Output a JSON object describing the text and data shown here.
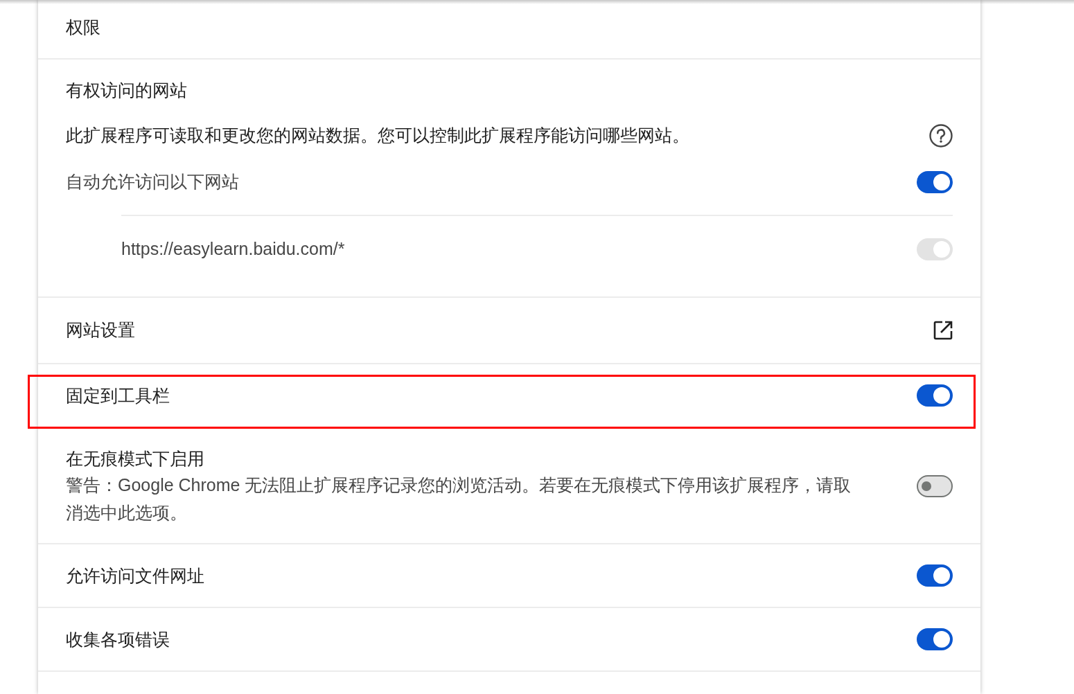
{
  "section_title": "权限",
  "site_access": {
    "title": "有权访问的网站",
    "description": "此扩展程序可读取和更改您的网站数据。您可以控制此扩展程序能访问哪些网站。",
    "auto_allow": {
      "label": "自动允许访问以下网站",
      "on": true
    },
    "sites": [
      {
        "url": "https://easylearn.baidu.com/*",
        "on": true,
        "disabled": true
      }
    ]
  },
  "groups": [
    {
      "rows": [
        {
          "kind": "link",
          "label": "网站设置",
          "highlighted": false
        }
      ]
    },
    {
      "rows": [
        {
          "kind": "toggle",
          "label": "固定到工具栏",
          "on": true,
          "highlighted": true
        },
        {
          "kind": "toggle",
          "label": "在无痕模式下启用",
          "description": "警告：Google Chrome 无法阻止扩展程序记录您的浏览活动。若要在无痕模式下停用该扩展程序，请取消选中此选项。",
          "on": false,
          "highlighted": false
        }
      ]
    },
    {
      "rows": [
        {
          "kind": "toggle",
          "label": "允许访问文件网址",
          "on": true,
          "highlighted": false
        }
      ]
    },
    {
      "rows": [
        {
          "kind": "toggle",
          "label": "收集各项错误",
          "on": true,
          "highlighted": false
        }
      ]
    }
  ]
}
